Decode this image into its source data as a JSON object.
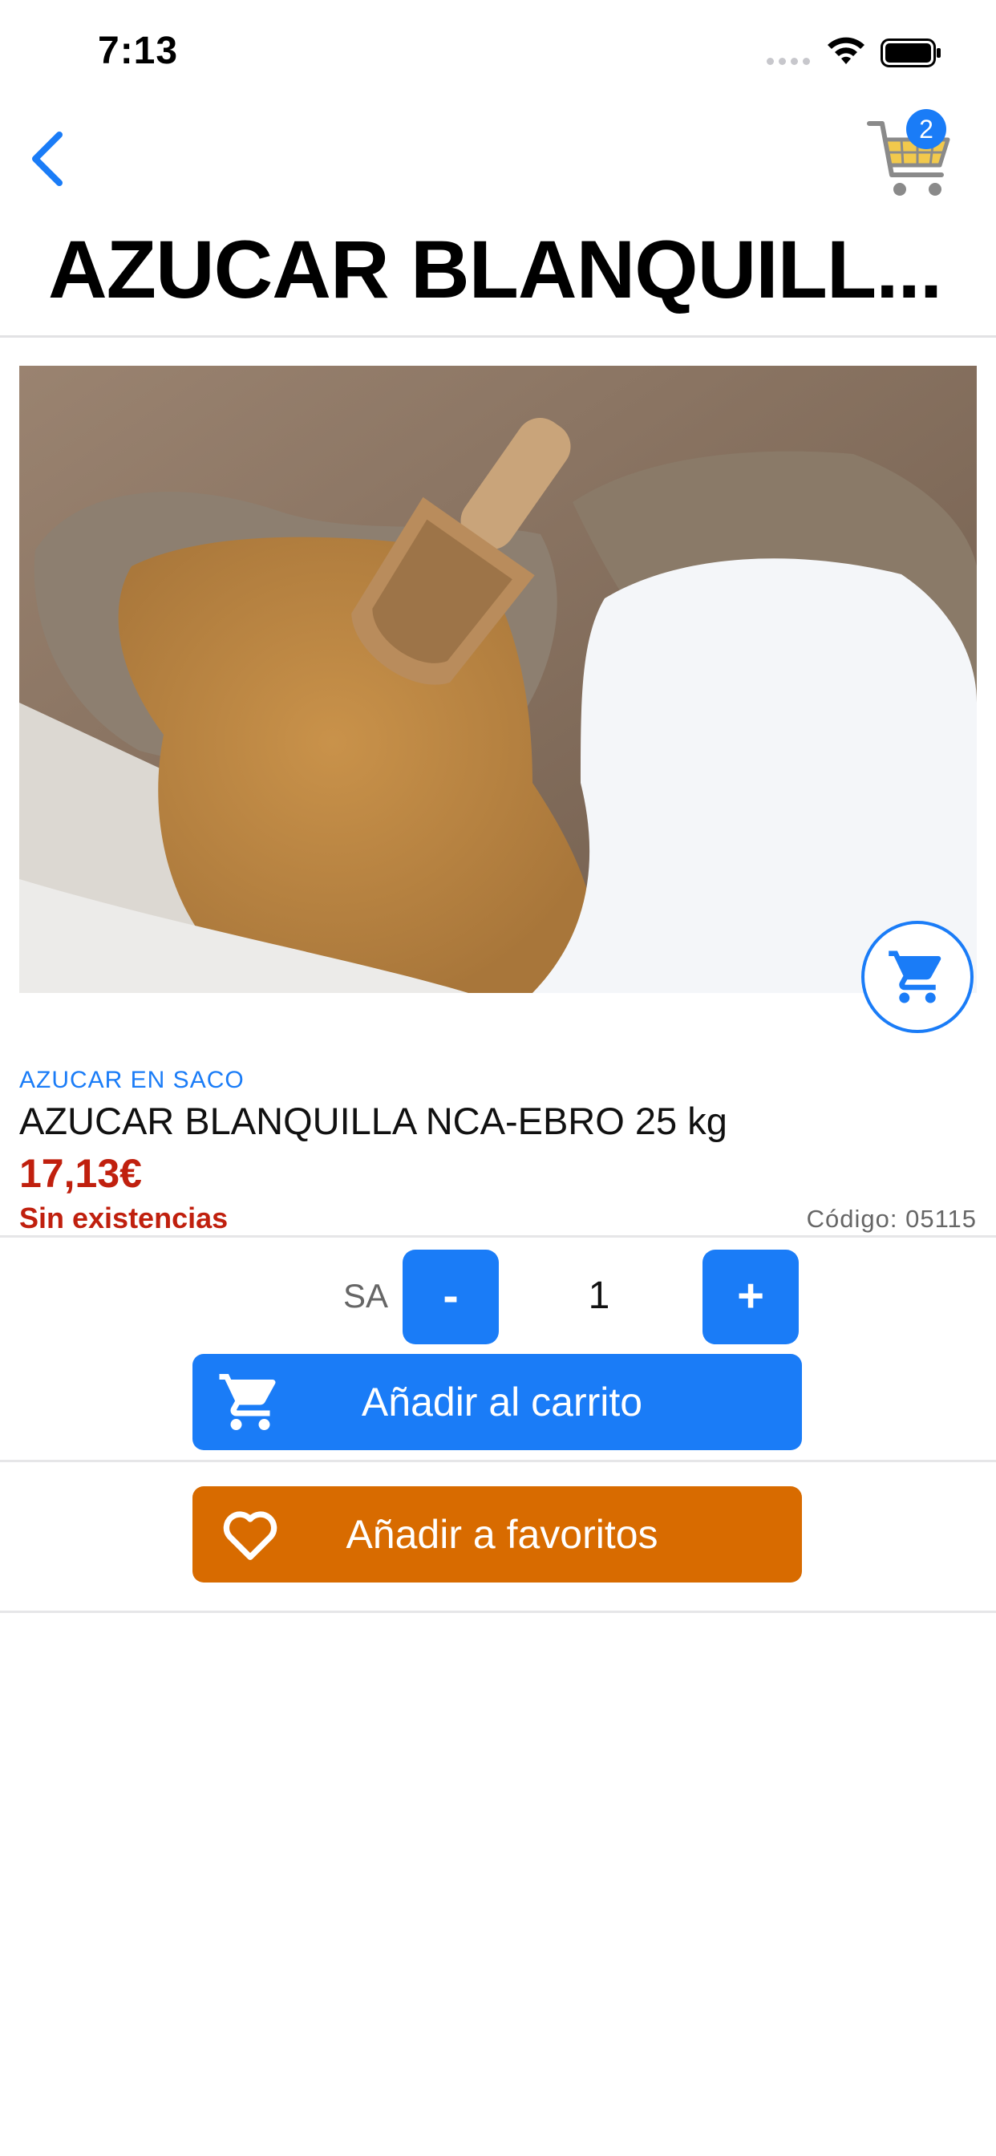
{
  "status_bar": {
    "time": "7:13"
  },
  "nav": {
    "cart_count": "2",
    "title": "AZUCAR BLANQUILL..."
  },
  "product": {
    "category": "AZUCAR EN SACO",
    "name": "AZUCAR BLANQUILLA NCA-EBRO 25 kg",
    "price": "17,13€",
    "stock_status": "Sin existencias",
    "code": "Código: 05115"
  },
  "quantity": {
    "unit": "SA",
    "minus_label": "-",
    "value": "1",
    "plus_label": "+"
  },
  "actions": {
    "add_to_cart": "Añadir al carrito",
    "add_to_favorites": "Añadir a favoritos"
  },
  "colors": {
    "accent": "#1a7cf7",
    "danger": "#c0200e",
    "favorite": "#d86b00"
  },
  "icons": [
    "back-chevron-icon",
    "cart-icon",
    "heart-icon",
    "wifi-icon",
    "battery-icon"
  ]
}
